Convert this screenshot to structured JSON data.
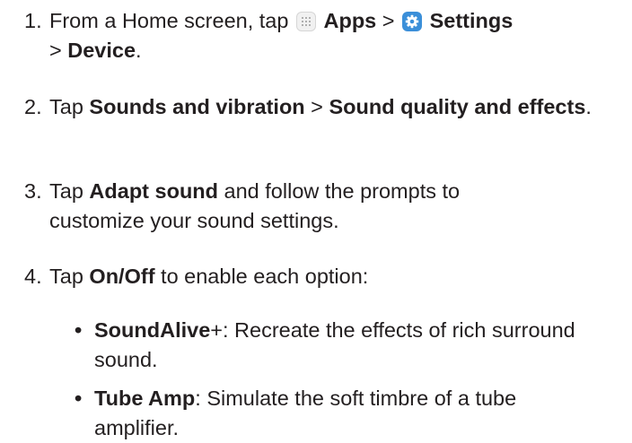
{
  "steps": [
    {
      "num": "1.",
      "pre": "From a Home screen, tap ",
      "apps": "Apps",
      "sep1": " > ",
      "settings": "Settings",
      "sep2": "> ",
      "device": "Device",
      "end": "."
    },
    {
      "num": "2.",
      "pre": "Tap ",
      "b1": "Sounds and vibration",
      "sep": " > ",
      "b2": "Sound quality and effects",
      "end": "."
    },
    {
      "num": "3.",
      "pre": "Tap ",
      "b1": "Adapt sound",
      "post": " and follow the prompts to customize your sound settings."
    },
    {
      "num": "4.",
      "pre": "Tap ",
      "b1": "On/Off",
      "post": " to enable each option:"
    }
  ],
  "bullets": [
    {
      "dot": "•",
      "title": "SoundAlive",
      "title_suffix": "+",
      "text": ": Recreate the effects of rich surround sound."
    },
    {
      "dot": "•",
      "title": "Tube Amp",
      "text": ": Simulate the soft timbre of a tube amplifier."
    }
  ],
  "icons": {
    "apps": "apps-grid-icon",
    "settings": "settings-gear-icon",
    "settings_color": "#3b8fd9"
  }
}
